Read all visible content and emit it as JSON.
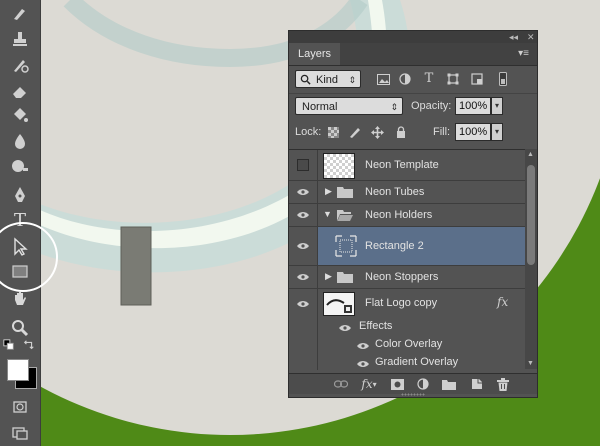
{
  "toolbar": {
    "tools": [
      {
        "name": "brush-icon"
      },
      {
        "name": "clone-stamp-icon"
      },
      {
        "name": "history-brush-icon"
      },
      {
        "name": "eraser-icon"
      },
      {
        "name": "paint-bucket-icon"
      },
      {
        "name": "blur-icon"
      },
      {
        "name": "dodge-icon"
      },
      {
        "name": "pen-icon"
      },
      {
        "name": "type-icon"
      },
      {
        "name": "path-selection-icon"
      },
      {
        "name": "rectangle-tool-icon"
      },
      {
        "name": "hand-icon"
      },
      {
        "name": "zoom-icon"
      },
      {
        "name": "default-colors-icon"
      },
      {
        "name": "swap-colors-icon"
      },
      {
        "name": "quick-mask-icon"
      },
      {
        "name": "screen-mode-icon"
      }
    ],
    "type_tool_glyph": "T",
    "foreground_color": "#ffffff",
    "background_color": "#000000",
    "selected_tool": "rectangle-tool-icon"
  },
  "panel": {
    "tab_label": "Layers",
    "menu_glyph": "▾≡",
    "collapse_glyph": "◂◂",
    "close_glyph": "✕",
    "filter": {
      "label": "Kind",
      "icons": [
        "pixel-filter-icon",
        "adjustment-filter-icon",
        "type-filter-icon",
        "shape-filter-icon",
        "smart-object-filter-icon",
        "filter-toggle-icon"
      ],
      "type_glyph": "T"
    },
    "blend_mode": "Normal",
    "opacity_label": "Opacity:",
    "opacity_value": "100%",
    "lock_label": "Lock:",
    "fill_label": "Fill:",
    "fill_value": "100%"
  },
  "layers": [
    {
      "name": "Neon Template",
      "visible": false,
      "kind": "pixel"
    },
    {
      "name": "Neon Tubes",
      "visible": true,
      "kind": "group",
      "expanded": false
    },
    {
      "name": "Neon Holders",
      "visible": true,
      "kind": "group",
      "expanded": true
    },
    {
      "name": "Rectangle 2",
      "visible": true,
      "kind": "shape",
      "selected": true
    },
    {
      "name": "Neon Stoppers",
      "visible": true,
      "kind": "group",
      "expanded": false
    },
    {
      "name": "Flat Logo copy",
      "visible": true,
      "kind": "smart",
      "fx": "fx"
    },
    {
      "name": "Effects",
      "visible": true,
      "kind": "effects"
    },
    {
      "name": "Color Overlay",
      "visible": true,
      "kind": "effect"
    },
    {
      "name": "Gradient Overlay",
      "visible": true,
      "kind": "effect"
    }
  ],
  "footer": {
    "fx_label": "fx",
    "icons": [
      "link-layers-icon",
      "add-style-icon",
      "add-mask-icon",
      "adjustment-layer-icon",
      "new-group-icon",
      "new-layer-icon",
      "delete-layer-icon"
    ]
  },
  "colors": {
    "canvas_green": "#4f8a17",
    "ui_panel": "#535353",
    "selection": "#5b6f8a",
    "logo_gray": "#d9d7d1"
  }
}
